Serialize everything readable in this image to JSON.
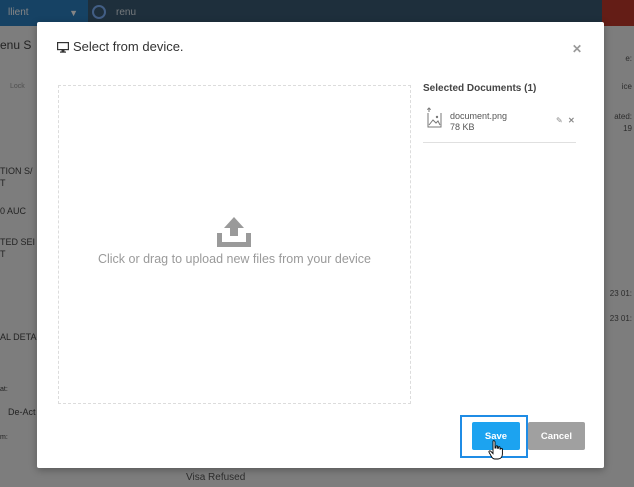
{
  "background": {
    "client_label": "llient",
    "search_text": "renu",
    "left_texts": [
      "enu S",
      "Lock",
      "TION S/",
      "T",
      "0 AUC",
      "TED SEI",
      "T",
      "AL DETA",
      "at:",
      "De-Act",
      "m:"
    ],
    "right_texts": [
      "e:",
      "ice",
      "ated:",
      "19",
      "23 01:",
      "23 01:"
    ],
    "bottom_text": "Visa Refused"
  },
  "modal": {
    "title": "Select from device.",
    "dropzone_text": "Click or drag to upload new files from your device",
    "selected_title": "Selected Documents (1)",
    "documents": [
      {
        "name": "document.png",
        "size": "78 KB"
      }
    ],
    "save_label": "Save",
    "cancel_label": "Cancel"
  },
  "colors": {
    "save": "#1ca3f0",
    "cancel": "#a0a0a0",
    "focus_outline": "#1f8ce5"
  }
}
